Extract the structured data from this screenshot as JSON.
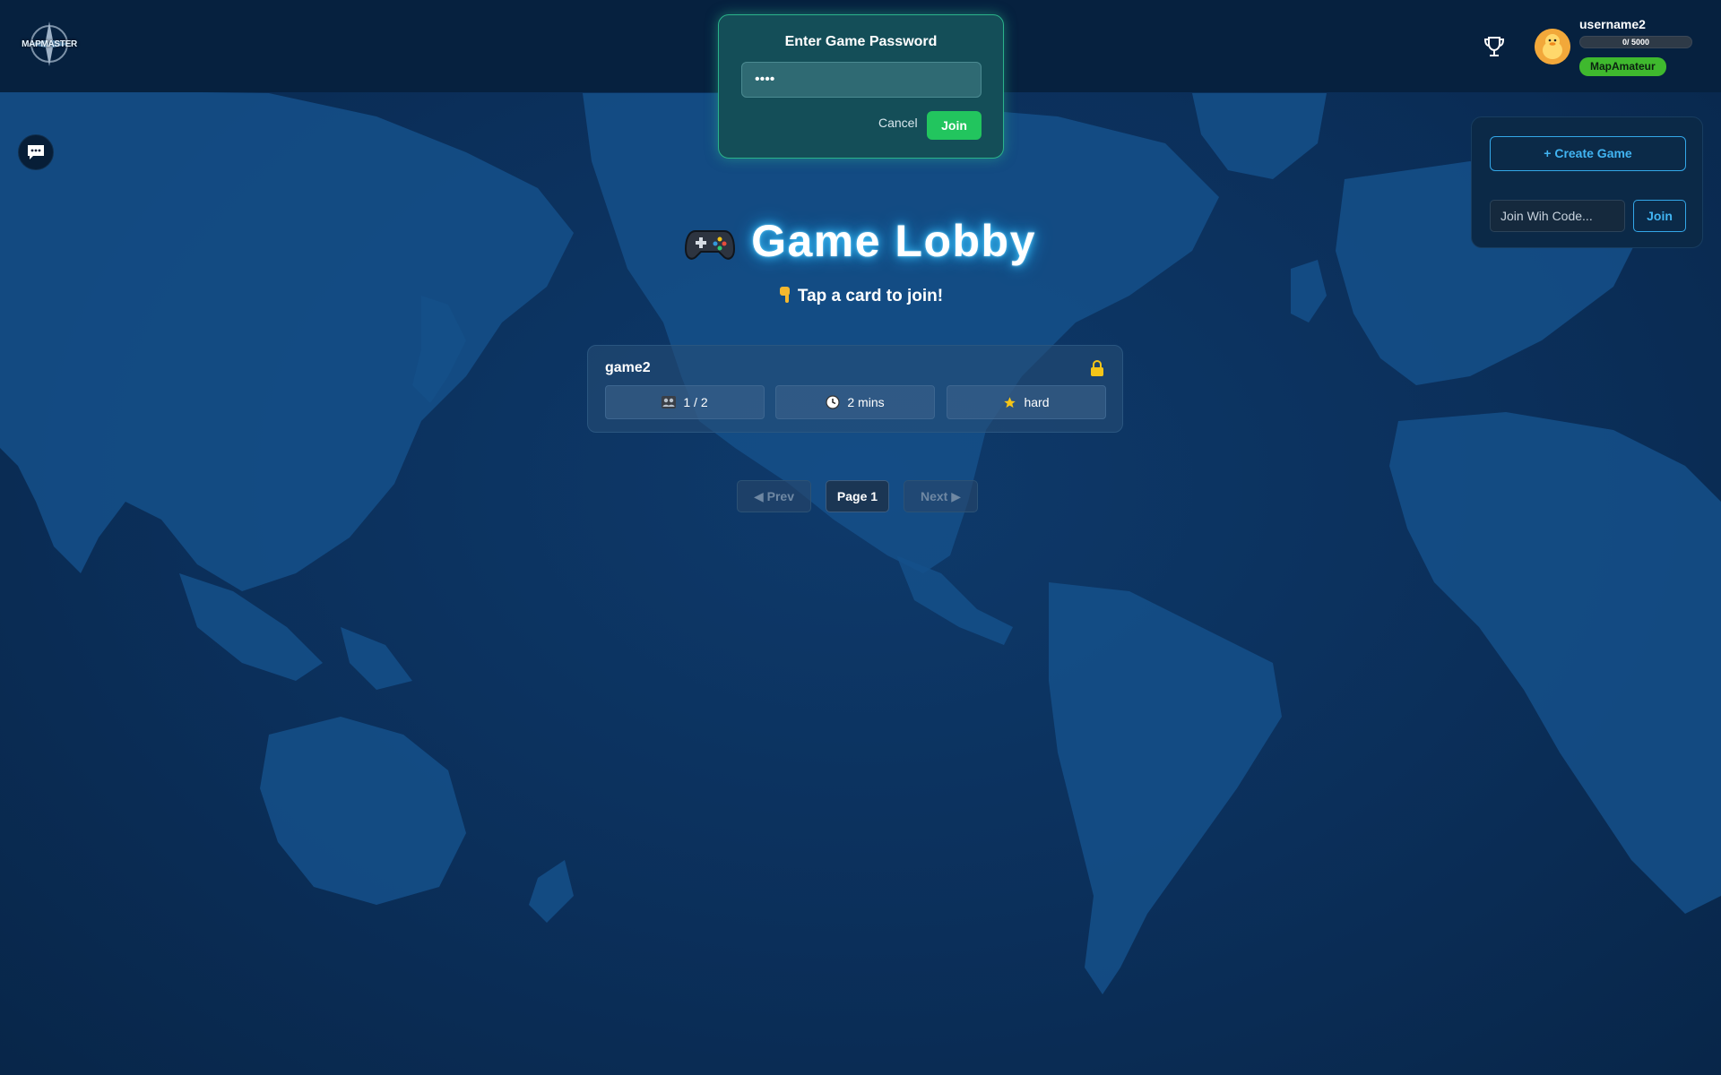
{
  "header": {
    "logo_text": "MAPMASTER",
    "username": "username2",
    "xp_text": "0/ 5000",
    "rank": "MapAmateur"
  },
  "password_modal": {
    "title": "Enter Game Password",
    "input_value": "••••",
    "cancel_label": "Cancel",
    "join_label": "Join"
  },
  "side_panel": {
    "create_label": "+ Create Game",
    "code_placeholder": "Join Wih Code...",
    "join_label": "Join"
  },
  "lobby": {
    "title": "Game Lobby",
    "subtitle": "Tap a card to join!"
  },
  "games": [
    {
      "name": "game2",
      "players": "1 / 2",
      "duration": "2 mins",
      "difficulty": "hard",
      "locked": true
    }
  ],
  "pagination": {
    "prev_label": "◀ Prev",
    "current_label": "Page 1",
    "next_label": "Next ▶"
  },
  "colors": {
    "accent_green": "#22c55e",
    "accent_blue": "#41b4f2",
    "rank_green": "#3fb92e",
    "background": "#0b2e57"
  },
  "icons": {
    "chat": "chat-bubble-icon",
    "trophy": "trophy-icon",
    "lock": "lock-icon",
    "players": "players-icon",
    "clock": "clock-icon",
    "star": "star-icon",
    "gamepad": "gamepad-icon",
    "hand": "pointing-hand-icon"
  }
}
